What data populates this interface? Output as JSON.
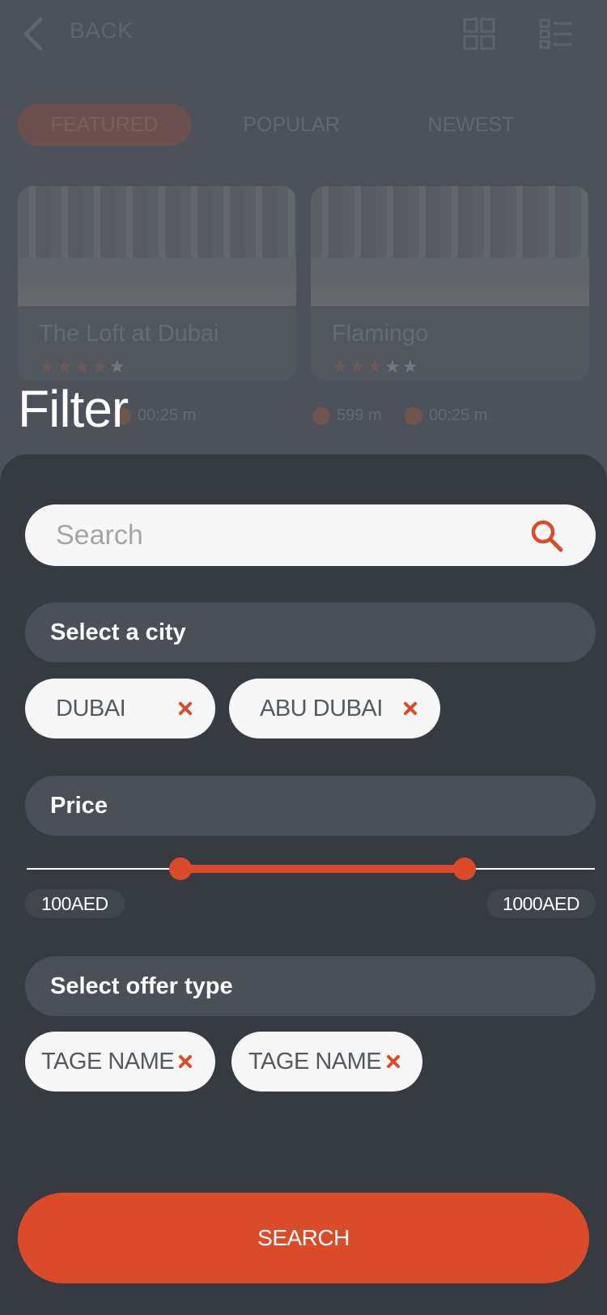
{
  "background": {
    "back_label": "BACK",
    "tabs": [
      {
        "label": "FEATURED",
        "active": true
      },
      {
        "label": "POPULAR",
        "active": false
      },
      {
        "label": "NEWEST",
        "active": false
      }
    ],
    "cards": [
      {
        "title": "The Loft at Dubai",
        "rating": 4,
        "max_rating": 5
      },
      {
        "title": "Flamingo",
        "rating": 3,
        "max_rating": 5
      }
    ],
    "meta": [
      {
        "value": "00:25 m"
      },
      {
        "value": "599 m"
      },
      {
        "value": "00:25 m"
      }
    ]
  },
  "filter": {
    "title": "Filter",
    "search": {
      "placeholder": "Search",
      "value": ""
    },
    "city": {
      "label": "Select a city",
      "chips": [
        {
          "label": "DUBAI"
        },
        {
          "label": "ABU DUBAI"
        }
      ]
    },
    "price": {
      "label": "Price",
      "min_label": "100AED",
      "max_label": "1000AED",
      "range_low_fraction": 0.27,
      "range_high_fraction": 0.77
    },
    "offer": {
      "label": "Select offer type",
      "chips": [
        {
          "label": "TAGE NAME"
        },
        {
          "label": "TAGE NAME"
        }
      ]
    },
    "search_button_label": "SEARCH"
  },
  "colors": {
    "accent": "#dc4b29",
    "sheet": "#363b42",
    "section_header": "#4b5058",
    "chip": "#f7f7f7"
  },
  "icons": {
    "back": "chevron-left-icon",
    "grid": "grid-view-icon",
    "list": "list-view-icon",
    "search": "search-icon",
    "chip_remove": "close-icon"
  }
}
